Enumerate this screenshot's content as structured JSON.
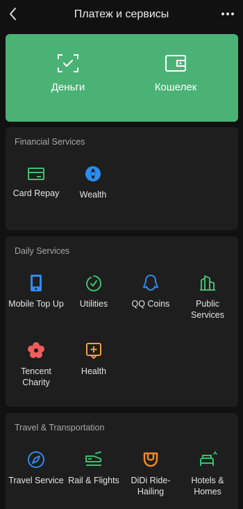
{
  "header": {
    "title": "Платеж и сервисы"
  },
  "hero": {
    "money_label": "Деньги",
    "wallet_label": "Кошелек",
    "color": "#4bb276"
  },
  "financial": {
    "title": "Financial Services",
    "items": [
      {
        "label": "Card Repay",
        "icon": "card-icon"
      },
      {
        "label": "Wealth",
        "icon": "wealth-icon"
      }
    ]
  },
  "daily": {
    "title": "Daily Services",
    "items": [
      {
        "label": "Mobile Top Up",
        "icon": "phone-icon"
      },
      {
        "label": "Utilities",
        "icon": "utilities-icon"
      },
      {
        "label": "QQ Coins",
        "icon": "qq-icon"
      },
      {
        "label": "Public Services",
        "icon": "city-icon"
      },
      {
        "label": "Tencent Charity",
        "icon": "charity-icon"
      },
      {
        "label": "Health",
        "icon": "health-icon"
      }
    ]
  },
  "travel": {
    "title": "Travel & Transportation",
    "items": [
      {
        "label": "Travel Service",
        "icon": "compass-icon"
      },
      {
        "label": "Rail & Flights",
        "icon": "train-icon"
      },
      {
        "label": "DiDi Ride-Hailing",
        "icon": "didi-icon"
      },
      {
        "label": "Hotels & Homes",
        "icon": "bed-icon"
      }
    ]
  }
}
